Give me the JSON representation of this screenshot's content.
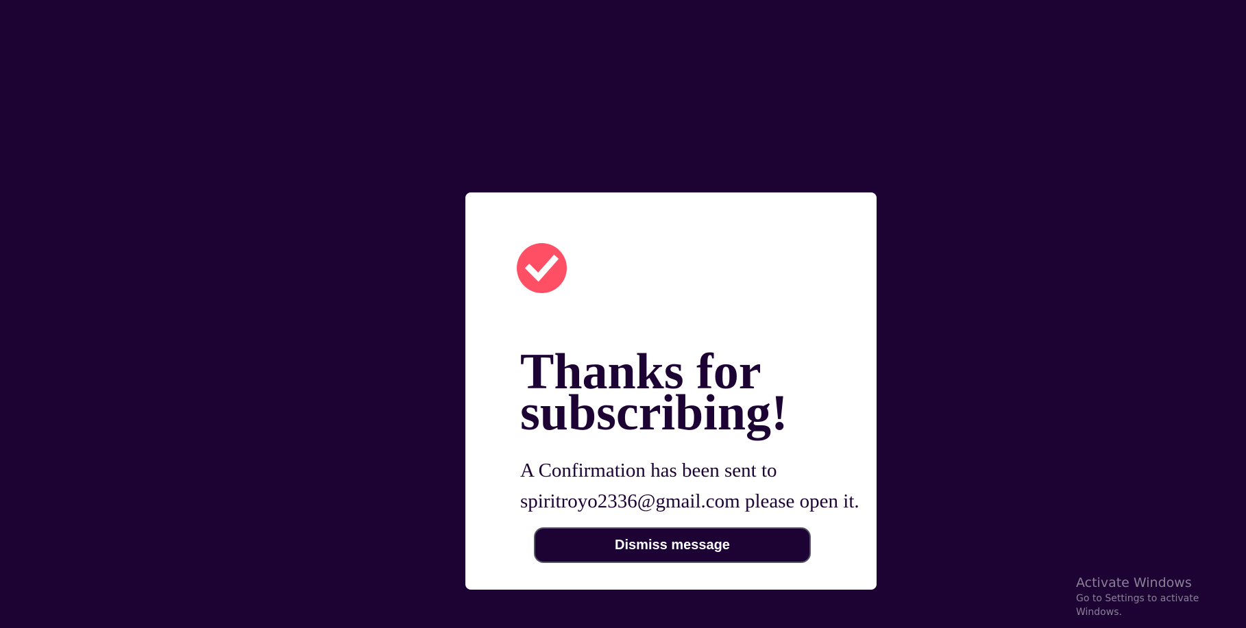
{
  "colors": {
    "page_background": "#1d0334",
    "card_background": "#ffffff",
    "accent": "#ff4f64",
    "text": "#1d0334",
    "button_background": "#1d0334",
    "button_text": "#ffffff"
  },
  "card": {
    "icon": "check-circle-icon",
    "title": "Thanks for subscribing!",
    "message_line1": "A Confirmation has been sent to",
    "email": "spiritroyo2336@gmail.com",
    "message_suffix": " please open it.",
    "dismiss_label": "Dismiss message"
  },
  "watermark": {
    "title": "Activate Windows",
    "subtitle": "Go to Settings to activate Windows."
  }
}
